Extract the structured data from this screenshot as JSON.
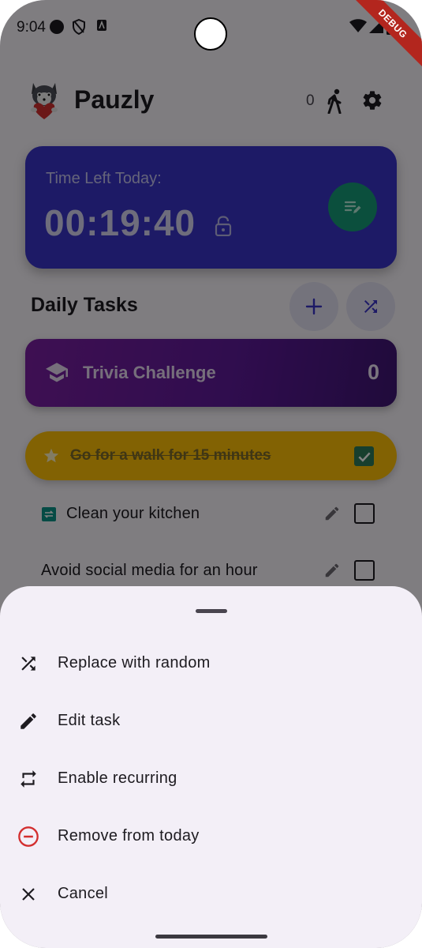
{
  "status_bar": {
    "time": "9:04",
    "debug_label": "DEBUG"
  },
  "header": {
    "title": "Pauzly",
    "steps_count": "0"
  },
  "timer": {
    "label": "Time Left Today:",
    "value": "00:19:40"
  },
  "daily_tasks": {
    "title": "Daily Tasks",
    "trivia": {
      "label": "Trivia Challenge",
      "count": "0"
    },
    "featured": {
      "label": "Go for a walk for 15 minutes",
      "completed": true
    },
    "items": [
      {
        "label": "Clean your kitchen",
        "has_recurring_icon": true,
        "checked": false
      },
      {
        "label": "Avoid social media for an hour",
        "has_recurring_icon": false,
        "checked": false
      }
    ]
  },
  "sheet": {
    "items": [
      {
        "label": "Replace with random",
        "icon": "shuffle-icon"
      },
      {
        "label": "Edit task",
        "icon": "pencil-icon"
      },
      {
        "label": "Enable recurring",
        "icon": "repeat-icon"
      },
      {
        "label": "Remove from today",
        "icon": "remove-circle-icon",
        "color": "#d32f2f"
      },
      {
        "label": "Cancel",
        "icon": "close-icon"
      }
    ]
  },
  "colors": {
    "timer_card": "#3a34c8",
    "timer_fab": "#179c78",
    "trivia_gradient_start": "#7b1fa2",
    "featured_task": "#ffc107",
    "remove_icon": "#d32f2f",
    "sheet_background": "#f3eff7"
  }
}
